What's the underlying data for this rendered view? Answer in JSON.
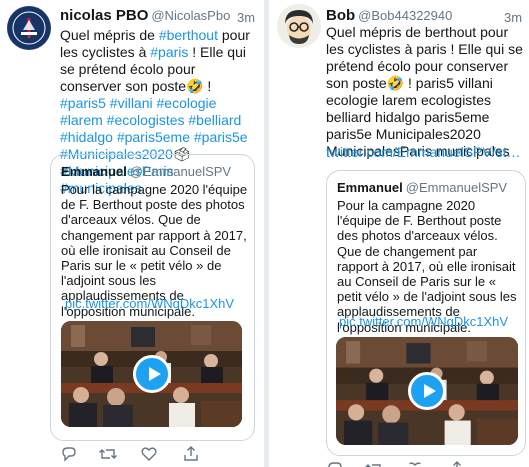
{
  "left_tweet": {
    "author_name": "nicolas PBO",
    "author_handle": "@NicolasPbo",
    "time": "3m",
    "text_parts": [
      {
        "t": "Quel mépris de ",
        "c": "plain"
      },
      {
        "t": "#berthout",
        "c": "ht"
      },
      {
        "t": " pour les cyclistes à ",
        "c": "plain"
      },
      {
        "t": "#paris",
        "c": "ht"
      },
      {
        "t": " ! Elle qui se prétend écolo pour conserver son poste🤣 ! ",
        "c": "plain"
      },
      {
        "t": "#paris5 #villani #ecologie #larem #ecologistes #belliard #hidalgo #paris5eme #paris5e #Municipales2020",
        "c": "ht"
      },
      {
        "t": "🗳",
        "c": "plain"
      },
      {
        "t": " #MunicipalesParis #municipales",
        "c": "ht"
      }
    ],
    "quote": {
      "name": "Emmanuel",
      "handle": "@EmmanuelSPV",
      "text": "Pour la campagne 2020 l'équipe de F. Berthout poste des photos d'arceaux vélos. Que de changement par rapport à 2017, où elle ironisait au Conseil de Paris sur le « petit vélo » de l'adjoint sous les applaudissements de l'opposition municipale.",
      "link": "pic.twitter.com/WNqDkc1XhV"
    }
  },
  "right_tweet": {
    "author_name": "Bob",
    "author_handle": "@Bob44322940",
    "time": "3m",
    "text": "Quel mépris de  berthout pour les cyclistes à  paris ! Elle qui se prétend écolo pour conserver son poste🤣 ! paris5  villani  ecologie larem  ecologistes  belliard  hidalgo paris5eme  paris5e Municipales2020  MunicipalesParis municipales",
    "link": "twitter.com/EmmanuelSPV/st…",
    "quote": {
      "name": "Emmanuel",
      "handle": "@EmmanuelSPV",
      "text": "Pour la campagne 2020 l'équipe de F. Berthout poste des photos d'arceaux vélos. Que de changement par rapport à 2017, où elle ironisait au Conseil de Paris sur le « petit vélo » de l'adjoint sous les applaudissements de l'opposition municipale.",
      "link": "pic.twitter.com/WNqDkc1XhV"
    }
  },
  "icons": [
    "psg-logo-icon",
    "cartoon-avatar-icon",
    "play-icon",
    "reply-icon",
    "retweet-icon",
    "like-icon",
    "share-icon"
  ],
  "colors": {
    "link": "#1b95e0",
    "muted": "#657786",
    "border": "#ccd6dd",
    "play": "#1da1f2"
  }
}
